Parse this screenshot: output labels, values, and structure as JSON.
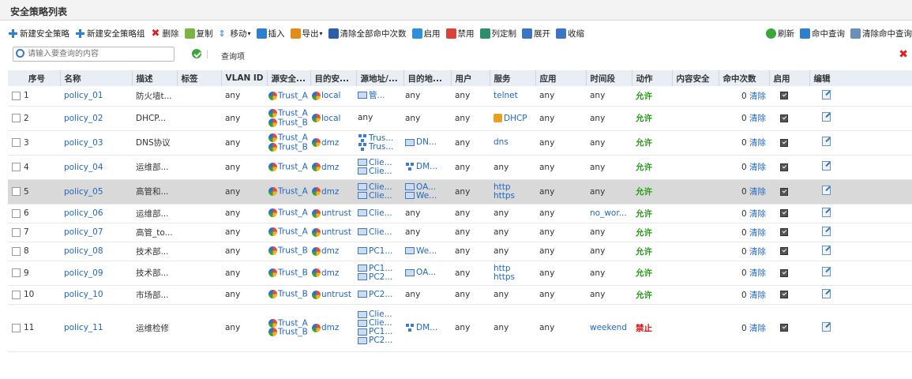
{
  "title": "安全策略列表",
  "toolbar": {
    "new_policy": "新建安全策略",
    "new_group": "新建安全策略组",
    "delete": "删除",
    "copy": "复制",
    "move": "移动",
    "insert": "插入",
    "export": "导出",
    "clear_all_hits": "清除全部命中次数",
    "enable": "启用",
    "disable": "禁用",
    "customize_columns": "列定制",
    "expand": "展开",
    "collapse": "收缩",
    "refresh": "刷新",
    "hit_query": "命中查询",
    "clear_hit_query": "清除命中查询"
  },
  "search": {
    "placeholder": "请输入要查询的内容",
    "query_items": "查询项"
  },
  "columns": [
    "序号",
    "名称",
    "描述",
    "标签",
    "VLAN ID",
    "源安全...",
    "目的安...",
    "源地址/...",
    "目的地...",
    "用户",
    "服务",
    "应用",
    "时间段",
    "动作",
    "内容安全",
    "命中次数",
    "启用",
    "编辑"
  ],
  "clear_label": "清除",
  "rows": [
    {
      "seq": "1",
      "name": "policy_01",
      "desc": "防火墙t...",
      "vlan": "any",
      "src_zone": [
        "Trust_A"
      ],
      "dst_zone": "local",
      "src_addr": [
        "管..."
      ],
      "src_addr_icon": "monitor",
      "dst_addr": "any",
      "user": "any",
      "service": "telnet",
      "app": "any",
      "time": "any",
      "action": "允许",
      "hits": "0"
    },
    {
      "seq": "2",
      "name": "policy_02",
      "desc": "DHCP...",
      "vlan": "any",
      "src_zone": [
        "Trust_A",
        "Trust_B"
      ],
      "dst_zone": "local",
      "src_addr": [
        "any"
      ],
      "src_addr_icon": "none",
      "dst_addr": "any",
      "user": "any",
      "service": "DHCP",
      "app": "any",
      "time": "any",
      "action": "允许",
      "hits": "0"
    },
    {
      "seq": "3",
      "name": "policy_03",
      "desc": "DNS协议",
      "vlan": "any",
      "src_zone": [
        "Trust_A",
        "Trust_B"
      ],
      "dst_zone": "dmz",
      "src_addr": [
        "Trus...",
        "Trus..."
      ],
      "src_addr_icon": "network",
      "dst_addr": "DN...",
      "user": "any",
      "service": "dns",
      "app": "any",
      "time": "any",
      "action": "允许",
      "hits": "0"
    },
    {
      "seq": "4",
      "name": "policy_04",
      "desc": "运维部...",
      "vlan": "any",
      "src_zone": [
        "Trust_A"
      ],
      "dst_zone": "dmz",
      "src_addr": [
        "Clie...",
        "Clie..."
      ],
      "src_addr_icon": "monitor",
      "dst_addr": "DM...",
      "user": "any",
      "service": "any",
      "app": "any",
      "time": "any",
      "action": "允许",
      "hits": "0"
    },
    {
      "seq": "5",
      "name": "policy_05",
      "desc": "高管和...",
      "vlan": "any",
      "src_zone": [
        "Trust_A"
      ],
      "dst_zone": "dmz",
      "src_addr": [
        "Clie...",
        "Clie..."
      ],
      "src_addr_icon": "monitor",
      "dst_addr": "OA...",
      "dst_addr2": "We...",
      "user": "any",
      "service": "http",
      "service2": "https",
      "app": "any",
      "time": "any",
      "action": "允许",
      "hits": "0"
    },
    {
      "seq": "6",
      "name": "policy_06",
      "desc": "运维部...",
      "vlan": "any",
      "src_zone": [
        "Trust_A"
      ],
      "dst_zone": "untrust",
      "src_addr": [
        "Clie..."
      ],
      "src_addr_icon": "monitor",
      "dst_addr": "any",
      "user": "any",
      "service": "any",
      "app": "any",
      "time": "no_wor...",
      "action": "允许",
      "hits": "0"
    },
    {
      "seq": "7",
      "name": "policy_07",
      "desc": "高管_to...",
      "vlan": "any",
      "src_zone": [
        "Trust_A"
      ],
      "dst_zone": "untrust",
      "src_addr": [
        "Clie..."
      ],
      "src_addr_icon": "monitor",
      "dst_addr": "any",
      "user": "any",
      "service": "any",
      "app": "any",
      "time": "any",
      "action": "允许",
      "hits": "0"
    },
    {
      "seq": "8",
      "name": "policy_08",
      "desc": "技术部...",
      "vlan": "any",
      "src_zone": [
        "Trust_B"
      ],
      "dst_zone": "dmz",
      "src_addr": [
        "PC1..."
      ],
      "src_addr_icon": "monitor",
      "dst_addr": "We...",
      "user": "any",
      "service": "any",
      "app": "any",
      "time": "any",
      "action": "允许",
      "hits": "0"
    },
    {
      "seq": "9",
      "name": "policy_09",
      "desc": "技术部...",
      "vlan": "any",
      "src_zone": [
        "Trust_B"
      ],
      "dst_zone": "dmz",
      "src_addr": [
        "PC1...",
        "PC2..."
      ],
      "src_addr_icon": "monitor",
      "dst_addr": "OA...",
      "user": "any",
      "service": "http",
      "service2": "https",
      "app": "any",
      "time": "any",
      "action": "允许",
      "hits": "0"
    },
    {
      "seq": "10",
      "name": "policy_10",
      "desc": "市场部...",
      "vlan": "any",
      "src_zone": [
        "Trust_B"
      ],
      "dst_zone": "untrust",
      "src_addr": [
        "PC2..."
      ],
      "src_addr_icon": "monitor",
      "dst_addr": "any",
      "user": "any",
      "service": "any",
      "app": "any",
      "time": "any",
      "action": "允许",
      "hits": "0"
    },
    {
      "seq": "11",
      "name": "policy_11",
      "desc": "运维检修",
      "vlan": "any",
      "src_zone": [
        "Trust_A",
        "Trust_B"
      ],
      "dst_zone": "dmz",
      "src_addr": [
        "Clie...",
        "Clie...",
        "PC1...",
        "PC2..."
      ],
      "src_addr_icon": "monitor",
      "dst_addr": "DM...",
      "user": "any",
      "service": "any",
      "app": "any",
      "time": "weekend",
      "action": "禁止",
      "hits": "0"
    }
  ]
}
